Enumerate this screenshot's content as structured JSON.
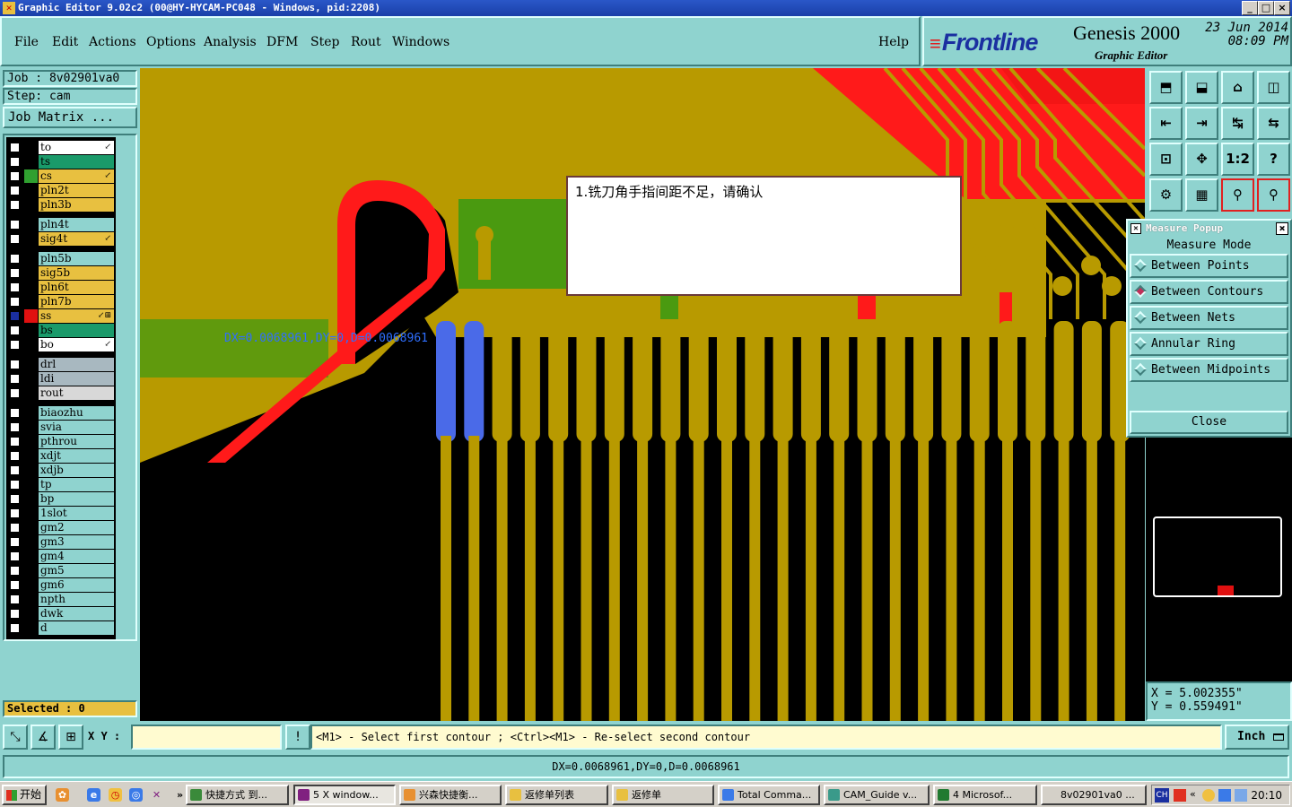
{
  "window": {
    "title": "Graphic Editor 9.02c2 (00@HY-HYCAM-PC048 - Windows, pid:2208)",
    "controls": {
      "minimize": "_",
      "maximize": "□",
      "close": "×"
    }
  },
  "menu": {
    "items": [
      "File",
      "Edit",
      "Actions",
      "Options",
      "Analysis",
      "DFM",
      "Step",
      "Rout",
      "Windows"
    ],
    "help": "Help"
  },
  "brand": {
    "logo": "Frontline",
    "product": "Genesis 2000",
    "subtitle": "Graphic Editor",
    "date": "23 Jun 2014",
    "time": "08:09 PM"
  },
  "job": {
    "job_line": "Job : 8v02901va0",
    "step_line": "Step: cam",
    "matrix_button": "Job Matrix ..."
  },
  "layers": [
    {
      "name": "to",
      "color": "#ffffff",
      "swatch": "#000000",
      "checked": false,
      "mark": "↙"
    },
    {
      "name": "ts",
      "color": "#1a9a6a",
      "swatch": "#000000",
      "checked": false,
      "mark": ""
    },
    {
      "name": "cs",
      "color": "#e8c040",
      "swatch": "#30a030",
      "checked": false,
      "mark": "↙"
    },
    {
      "name": "pln2t",
      "color": "#e8c040",
      "swatch": "#000000",
      "checked": false,
      "mark": ""
    },
    {
      "name": "pln3b",
      "color": "#e8c040",
      "swatch": "#000000",
      "checked": false,
      "mark": ""
    },
    {
      "name": "pln4t",
      "color": "#8fd3cf",
      "swatch": "#000000",
      "checked": false,
      "mark": ""
    },
    {
      "name": "sig4t",
      "color": "#e8c040",
      "swatch": "#000000",
      "checked": false,
      "mark": "↙"
    },
    {
      "name": "pln5b",
      "color": "#8fd3cf",
      "swatch": "#000000",
      "checked": false,
      "mark": ""
    },
    {
      "name": "sig5b",
      "color": "#e8c040",
      "swatch": "#000000",
      "checked": false,
      "mark": ""
    },
    {
      "name": "pln6t",
      "color": "#e8c040",
      "swatch": "#000000",
      "checked": false,
      "mark": ""
    },
    {
      "name": "pln7b",
      "color": "#e8c040",
      "swatch": "#000000",
      "checked": false,
      "mark": ""
    },
    {
      "name": "ss",
      "color": "#e8c040",
      "swatch": "#e01010",
      "checked": true,
      "mark": "↙⊞"
    },
    {
      "name": "bs",
      "color": "#1a9a6a",
      "swatch": "#000000",
      "checked": false,
      "mark": ""
    },
    {
      "name": "bo",
      "color": "#ffffff",
      "swatch": "#000000",
      "checked": false,
      "mark": "↙"
    },
    {
      "name": "drl",
      "color": "#a8b8c0",
      "swatch": "#000000",
      "checked": false,
      "mark": ""
    },
    {
      "name": "ldi",
      "color": "#a8b8c0",
      "swatch": "#000000",
      "checked": false,
      "mark": ""
    },
    {
      "name": "rout",
      "color": "#d8d8d8",
      "swatch": "#000000",
      "checked": false,
      "mark": ""
    },
    {
      "name": "biaozhu",
      "color": "#8fd3cf",
      "swatch": "#000000",
      "checked": false,
      "mark": ""
    },
    {
      "name": "svia",
      "color": "#8fd3cf",
      "swatch": "#000000",
      "checked": false,
      "mark": ""
    },
    {
      "name": "pthrou",
      "color": "#8fd3cf",
      "swatch": "#000000",
      "checked": false,
      "mark": ""
    },
    {
      "name": "xdjt",
      "color": "#8fd3cf",
      "swatch": "#000000",
      "checked": false,
      "mark": ""
    },
    {
      "name": "xdjb",
      "color": "#8fd3cf",
      "swatch": "#000000",
      "checked": false,
      "mark": ""
    },
    {
      "name": "tp",
      "color": "#8fd3cf",
      "swatch": "#000000",
      "checked": false,
      "mark": ""
    },
    {
      "name": "bp",
      "color": "#8fd3cf",
      "swatch": "#000000",
      "checked": false,
      "mark": ""
    },
    {
      "name": "1slot",
      "color": "#8fd3cf",
      "swatch": "#000000",
      "checked": false,
      "mark": ""
    },
    {
      "name": "gm2",
      "color": "#8fd3cf",
      "swatch": "#000000",
      "checked": false,
      "mark": ""
    },
    {
      "name": "gm3",
      "color": "#8fd3cf",
      "swatch": "#000000",
      "checked": false,
      "mark": ""
    },
    {
      "name": "gm4",
      "color": "#8fd3cf",
      "swatch": "#000000",
      "checked": false,
      "mark": ""
    },
    {
      "name": "gm5",
      "color": "#8fd3cf",
      "swatch": "#000000",
      "checked": false,
      "mark": ""
    },
    {
      "name": "gm6",
      "color": "#8fd3cf",
      "swatch": "#000000",
      "checked": false,
      "mark": ""
    },
    {
      "name": "npth",
      "color": "#8fd3cf",
      "swatch": "#000000",
      "checked": false,
      "mark": ""
    },
    {
      "name": "dwk",
      "color": "#8fd3cf",
      "swatch": "#000000",
      "checked": false,
      "mark": ""
    },
    {
      "name": "d",
      "color": "#8fd3cf",
      "swatch": "#000000",
      "checked": false,
      "mark": ""
    }
  ],
  "selected": "Selected : 0",
  "canvas": {
    "dialog_text": "1.铣刀角手指间距不足，请确认",
    "measure_text": "DX=0.0068961,DY=0,D=0.0068961",
    "colors": {
      "copper": "#b89a00",
      "red": "#ff1a1a",
      "green": "#4a9a10",
      "blue": "#4a6ae8"
    }
  },
  "tools": [
    "⬒",
    "⬓",
    "⌂",
    "◫",
    "⇤",
    "⇥",
    "↹",
    "⇆",
    "⊡",
    "✥",
    "1:2",
    "?",
    "⚙",
    "▦",
    "⚲",
    "⚲"
  ],
  "measure_popup": {
    "title": "Measure Popup",
    "header": "Measure Mode",
    "options": [
      "Between Points",
      "Between Contours",
      "Between Nets",
      "Annular Ring",
      "Between Midpoints"
    ],
    "selected_index": 1,
    "close": "Close"
  },
  "coords": {
    "x": "X = 5.002355\"",
    "y": "Y = 0.559491\""
  },
  "command": {
    "xy_label": "X Y :",
    "xy_value": "",
    "prompt": "<M1> - Select first contour ; <Ctrl><M1> - Re-select second contour",
    "unit": "Inch"
  },
  "status": "DX=0.0068961,DY=0,D=0.0068961",
  "taskbar": {
    "start": "开始",
    "tasks": [
      "快捷方式 到...",
      "5 X window...",
      "兴森快捷衡...",
      "返修单列表",
      "返修单",
      "Total Comma...",
      "CAM_Guide v...",
      "4 Microsof...",
      "8v02901va0 ..."
    ],
    "active_index": 1,
    "lang": "CH",
    "clock": "20:10"
  }
}
